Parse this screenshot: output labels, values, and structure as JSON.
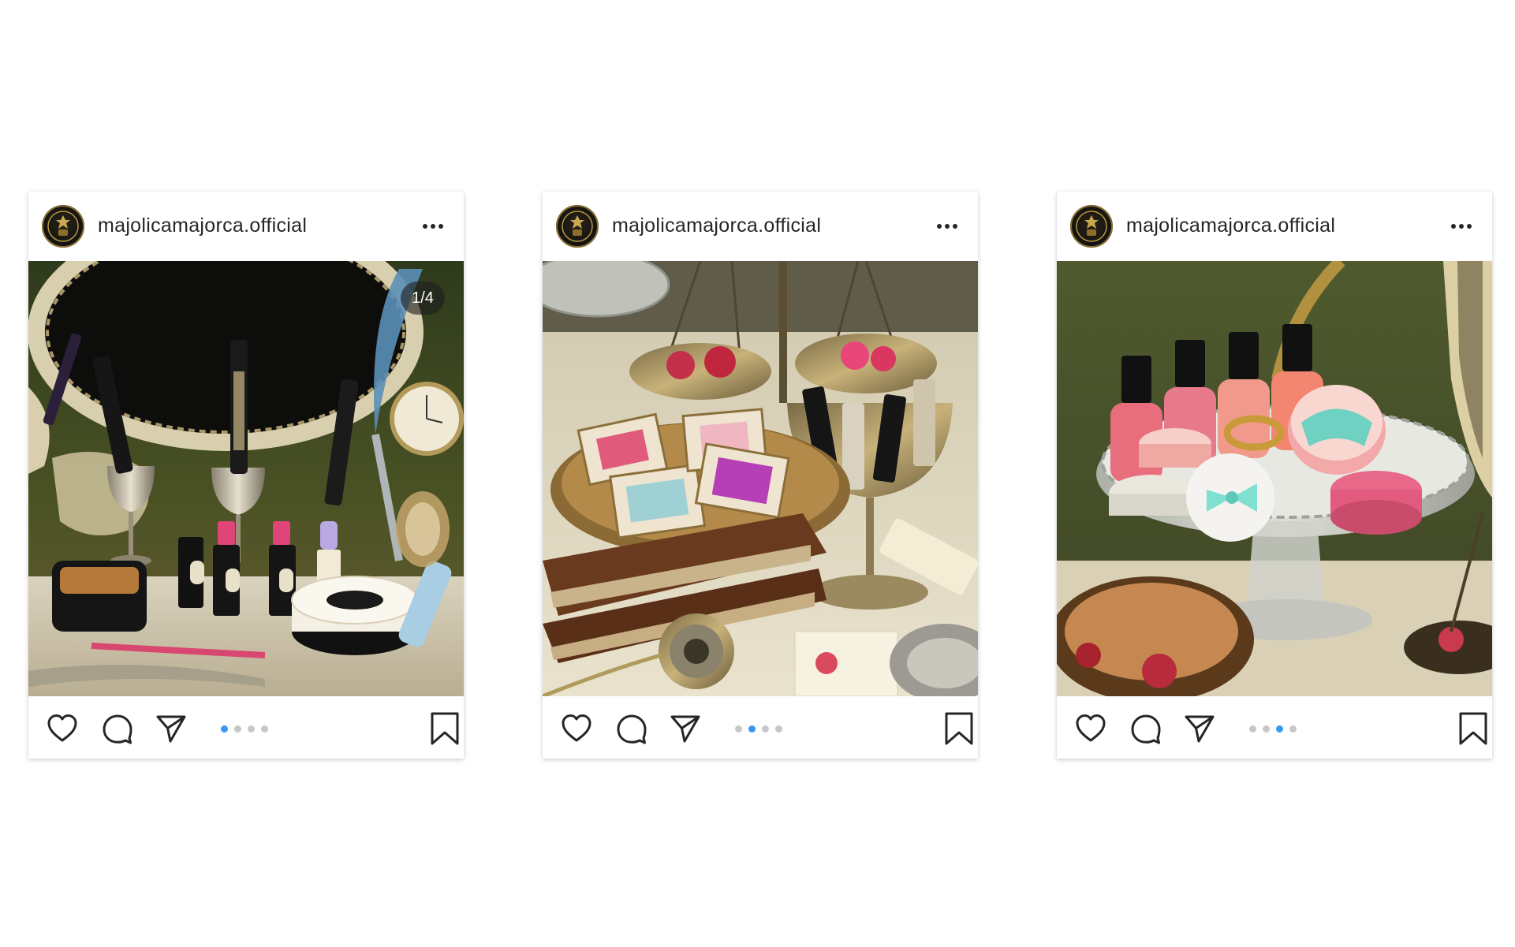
{
  "posts": [
    {
      "username": "majolicamajorca.official",
      "counter": "1/4",
      "carousel": {
        "total": 4,
        "active_index": 0
      },
      "actions": [
        "like",
        "comment",
        "share",
        "save"
      ]
    },
    {
      "username": "majolicamajorca.official",
      "carousel": {
        "total": 4,
        "active_index": 1
      },
      "actions": [
        "like",
        "comment",
        "share",
        "save"
      ]
    },
    {
      "username": "majolicamajorca.official",
      "carousel": {
        "total": 4,
        "active_index": 2
      },
      "actions": [
        "like",
        "comment",
        "share",
        "save"
      ]
    }
  ],
  "icons": {
    "more": "more-horizontal-icon",
    "like": "heart-outline-icon",
    "comment": "speech-bubble-icon",
    "share": "paper-plane-icon",
    "save": "bookmark-outline-icon"
  },
  "colors": {
    "text": "#262626",
    "dot_active": "#3897f0",
    "dot_inactive": "#c7c7c7",
    "card_background": "#ffffff"
  }
}
